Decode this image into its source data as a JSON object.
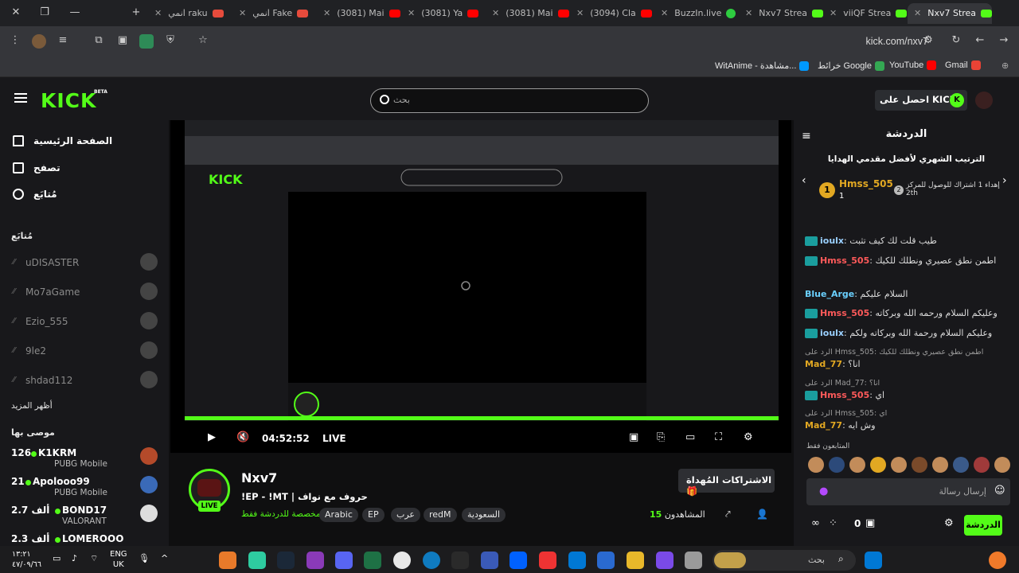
{
  "browser": {
    "tabs": [
      {
        "title": "انمي raku",
        "icon_color": "#e64b3c"
      },
      {
        "title": "انمي Fake",
        "icon_color": "#e64b3c"
      },
      {
        "title": "(3081) Mai",
        "icon_color": "#ff0000"
      },
      {
        "title": "(3081) Ya",
        "icon_color": "#ff0000"
      },
      {
        "title": "(3081) Mai",
        "icon_color": "#ff0000"
      },
      {
        "title": "(3094) Cla",
        "icon_color": "#ff0000"
      },
      {
        "title": "BuzzIn.live",
        "icon_color": "#2ecc40"
      },
      {
        "title": "Nxv7 Strea",
        "icon_color": "#53fc18"
      },
      {
        "title": "viiQF Strea",
        "icon_color": "#53fc18"
      },
      {
        "title": "Nxv7 Strea",
        "icon_color": "#53fc18"
      }
    ],
    "url": "kick.com/nxv7",
    "bookmarks": [
      {
        "label": "WitAnime - مشاهدة...",
        "icon_color": "#0099ff"
      },
      {
        "label": "خرائط Google",
        "icon_color": "#34a853"
      },
      {
        "label": "YouTube",
        "icon_color": "#ff0000"
      },
      {
        "label": "Gmail",
        "icon_color": "#ea4335"
      }
    ]
  },
  "header": {
    "logo": "KICK",
    "beta": "BETA",
    "search_placeholder": "بحث",
    "get_kicks": "احصل على KICKs"
  },
  "sidebar": {
    "nav": [
      {
        "label": "الصفحة الرئيسية",
        "icon": "home-icon"
      },
      {
        "label": "تصفح",
        "icon": "browse-icon"
      },
      {
        "label": "مُتابَع",
        "icon": "heart-icon"
      }
    ],
    "following_heading": "مُتابَع",
    "following": [
      "uDISASTER",
      "Mo7aGame",
      "Ezio_555",
      "9le2",
      "shdad112"
    ],
    "show_more": "أظهر المزيد",
    "recommended_heading": "موصى بها",
    "recommended": [
      {
        "count": "126",
        "name": "K1KRM",
        "game": "PUBG Mobile"
      },
      {
        "count": "21",
        "name": "Apolooo99",
        "game": "PUBG Mobile"
      },
      {
        "count": "2.7 ألف",
        "name": "BOND17",
        "game": "VALORANT"
      },
      {
        "count": "2.3 ألف",
        "name": "LOMEROOO",
        "game": ""
      }
    ]
  },
  "player": {
    "time": "04:52:52",
    "live": "LIVE"
  },
  "stream": {
    "name": "Nxv7",
    "title": "!EP - !MT | حروف مع نواف",
    "chat_only": "مخصصة للدردشة فقط",
    "tags": [
      "Arabic",
      "EP",
      "عرب",
      "redM",
      "السعودية"
    ],
    "live_badge": "LIVE",
    "gift_subs": "الاشتراكات المُهداة",
    "viewers_label": "المشاهدون",
    "viewers_count": "15"
  },
  "chat": {
    "title": "الدردشة",
    "leaderboard_title": "الترتيب الشهري لأفضل مقدمي الهدايا",
    "leader1": {
      "rank": "1",
      "name": "Hmss_505",
      "count": "1"
    },
    "leader2": {
      "rank": "2",
      "text": "إهداء 1 اشتراك للوصول للمركز 2th"
    },
    "messages": [
      {
        "user": "ioulx",
        "color": "#9ad0ff",
        "text": "طيب قلت لك كيف تثبت"
      },
      {
        "user": "Hmss_505",
        "color": "#ff5a5a",
        "text": "اطمن نطق عصيري ونطلك للكيك"
      },
      {
        "user": "Blue_Arge",
        "color": "#6ad0ff",
        "text": "السلام عليكم"
      },
      {
        "user": "Hmss_505",
        "color": "#ff5a5a",
        "text": "وعليكم السلام ورحمه الله وبركاته"
      },
      {
        "user": "ioulx",
        "color": "#9ad0ff",
        "text": "وعليكم السلام ورحمة الله وبركاته ولكم"
      }
    ],
    "replies": [
      {
        "reply": "الرد على Hmss_505: اطمن نطق عصيري ونطلك للكيك",
        "user": "Mad_77",
        "color": "#e2a822",
        "text": "انا؟"
      },
      {
        "reply": "الرد على Mad_77: انا؟",
        "user": "Hmss_505",
        "color": "#ff5a5a",
        "text": "اي"
      },
      {
        "reply": "الرد على Hmss_505: اي",
        "user": "Mad_77",
        "color": "#e2a822",
        "text": "وش ايه"
      }
    ],
    "subs_only": "المتابعون فقط",
    "input_placeholder": "إرسال رسالة",
    "send": "الدردشة",
    "points": "0"
  },
  "taskbar": {
    "time": "١٣:٢١",
    "date": "٤٧/٠٩/٦٦",
    "lang1": "ENG",
    "lang2": "UK",
    "search": "بحث"
  }
}
